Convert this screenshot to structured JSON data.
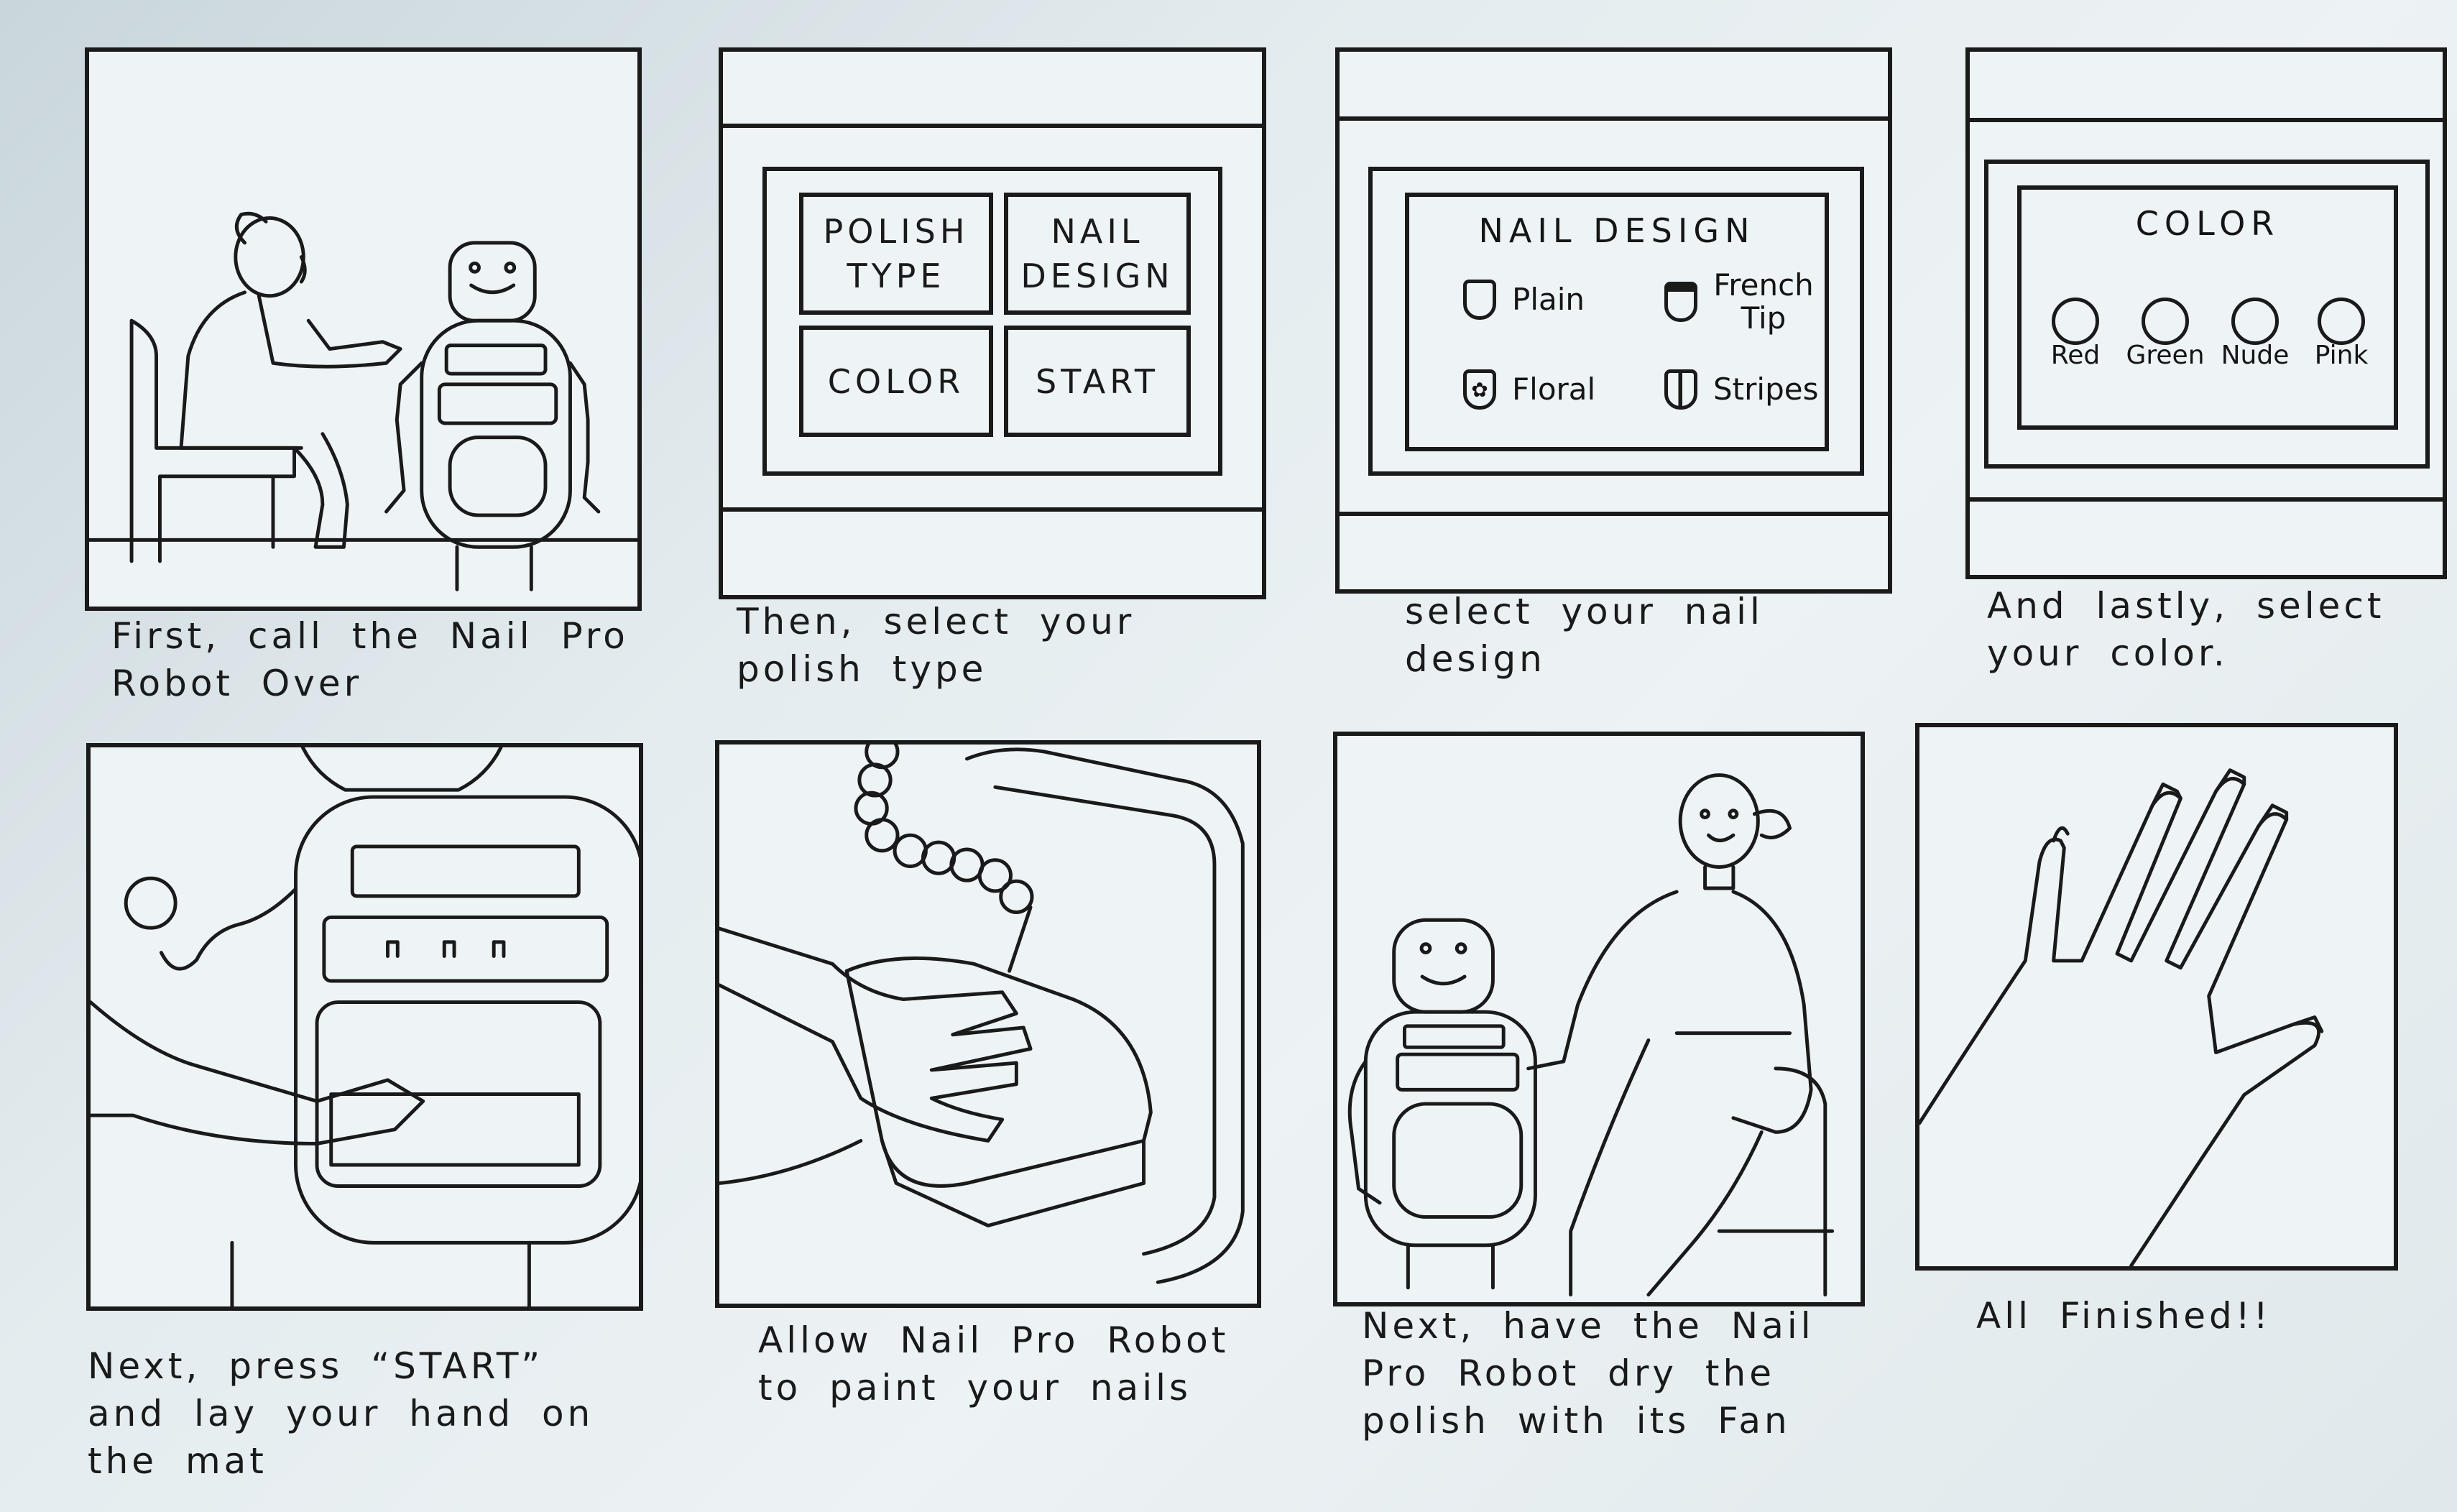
{
  "captions": {
    "p1": "First, call the Nail Pro Robot Over",
    "p2": "Then, select your polish type",
    "p3": "select your nail design",
    "p4": "And lastly, select your color.",
    "p5": "Next, press “START” and lay your hand on the mat",
    "p6": "Allow Nail Pro Robot to paint your nails",
    "p7": "Next, have the Nail Pro Robot dry the polish with its Fan",
    "p8": "All Finished!!"
  },
  "menu": {
    "polish_type": "POLISH TYPE",
    "nail_design": "NAIL DESIGN",
    "color": "COLOR",
    "start": "START"
  },
  "design_screen": {
    "title": "NAIL DESIGN",
    "options": [
      "Plain",
      "French Tip",
      "Floral",
      "Stripes"
    ]
  },
  "color_screen": {
    "title": "COLOR",
    "options": [
      "Red",
      "Green",
      "Nude",
      "Pink"
    ]
  }
}
